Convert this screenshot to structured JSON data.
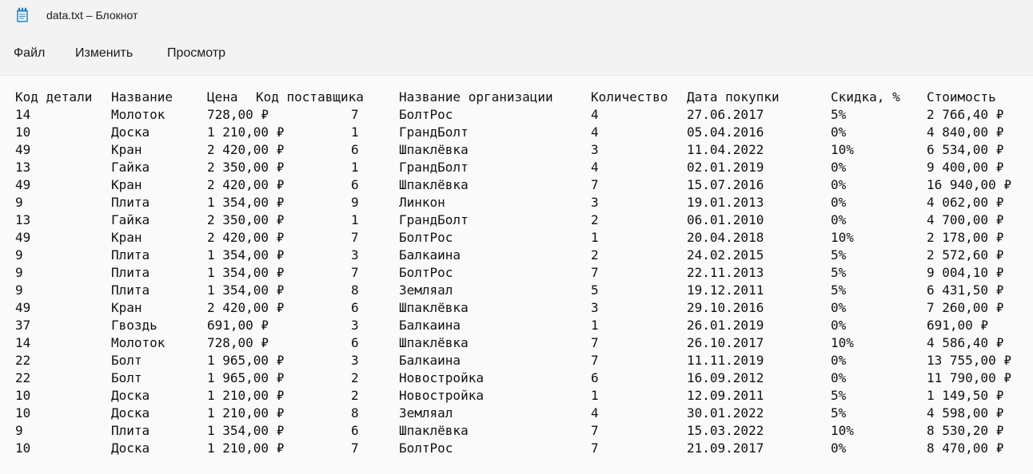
{
  "window": {
    "title": "data.txt – Блокнот",
    "icon": "notepad-icon"
  },
  "menu": {
    "items": [
      "Файл",
      "Изменить",
      "Просмотр"
    ]
  },
  "document": {
    "headers": [
      "Код детали",
      "Название",
      "Цена",
      "Код поставщика",
      "Название организации",
      "Количество",
      "Дата покупки",
      "Скидка, %",
      "Стоимость"
    ],
    "rows": [
      [
        "14",
        "Молоток",
        "728,00 ₽",
        "7",
        "БолтРос",
        "4",
        "27.06.2017",
        "5%",
        "2 766,40 ₽"
      ],
      [
        "10",
        "Доска",
        "1 210,00 ₽",
        "1",
        "ГрандБолт",
        "4",
        "05.04.2016",
        "0%",
        "4 840,00 ₽"
      ],
      [
        "49",
        "Кран",
        "2 420,00 ₽",
        "6",
        "Шпаклёвка",
        "3",
        "11.04.2022",
        "10%",
        "6 534,00 ₽"
      ],
      [
        "13",
        "Гайка",
        "2 350,00 ₽",
        "1",
        "ГрандБолт",
        "4",
        "02.01.2019",
        "0%",
        "9 400,00 ₽"
      ],
      [
        "49",
        "Кран",
        "2 420,00 ₽",
        "6",
        "Шпаклёвка",
        "7",
        "15.07.2016",
        "0%",
        "16 940,00 ₽"
      ],
      [
        "9",
        "Плита",
        "1 354,00 ₽",
        "9",
        "Линкон",
        "3",
        "19.01.2013",
        "0%",
        "4 062,00 ₽"
      ],
      [
        "13",
        "Гайка",
        "2 350,00 ₽",
        "1",
        "ГрандБолт",
        "2",
        "06.01.2010",
        "0%",
        "4 700,00 ₽"
      ],
      [
        "49",
        "Кран",
        "2 420,00 ₽",
        "7",
        "БолтРос",
        "1",
        "20.04.2018",
        "10%",
        "2 178,00 ₽"
      ],
      [
        "9",
        "Плита",
        "1 354,00 ₽",
        "3",
        "Балкаина",
        "2",
        "24.02.2015",
        "5%",
        "2 572,60 ₽"
      ],
      [
        "9",
        "Плита",
        "1 354,00 ₽",
        "7",
        "БолтРос",
        "7",
        "22.11.2013",
        "5%",
        "9 004,10 ₽"
      ],
      [
        "9",
        "Плита",
        "1 354,00 ₽",
        "8",
        "Земляал",
        "5",
        "19.12.2011",
        "5%",
        "6 431,50 ₽"
      ],
      [
        "49",
        "Кран",
        "2 420,00 ₽",
        "6",
        "Шпаклёвка",
        "3",
        "29.10.2016",
        "0%",
        "7 260,00 ₽"
      ],
      [
        "37",
        "Гвоздь",
        "691,00 ₽",
        "3",
        "Балкаина",
        "1",
        "26.01.2019",
        "0%",
        "691,00 ₽"
      ],
      [
        "14",
        "Молоток",
        "728,00 ₽",
        "6",
        "Шпаклёвка",
        "7",
        "26.10.2017",
        "10%",
        "4 586,40 ₽"
      ],
      [
        "22",
        "Болт",
        "1 965,00 ₽",
        "3",
        "Балкаина",
        "7",
        "11.11.2019",
        "0%",
        "13 755,00 ₽"
      ],
      [
        "22",
        "Болт",
        "1 965,00 ₽",
        "2",
        "Новостройка",
        "6",
        "16.09.2012",
        "0%",
        "11 790,00 ₽"
      ],
      [
        "10",
        "Доска",
        "1 210,00 ₽",
        "2",
        "Новостройка",
        "1",
        "12.09.2011",
        "5%",
        "1 149,50 ₽"
      ],
      [
        "10",
        "Доска",
        "1 210,00 ₽",
        "8",
        "Земляал",
        "4",
        "30.01.2022",
        "5%",
        "4 598,00 ₽"
      ],
      [
        "9",
        "Плита",
        "1 354,00 ₽",
        "6",
        "Шпаклёвка",
        "7",
        "15.03.2022",
        "10%",
        "8 530,20 ₽"
      ],
      [
        "10",
        "Доска",
        "1 210,00 ₽",
        "7",
        "БолтРос",
        "7",
        "21.09.2017",
        "0%",
        "8 470,00 ₽"
      ]
    ]
  }
}
